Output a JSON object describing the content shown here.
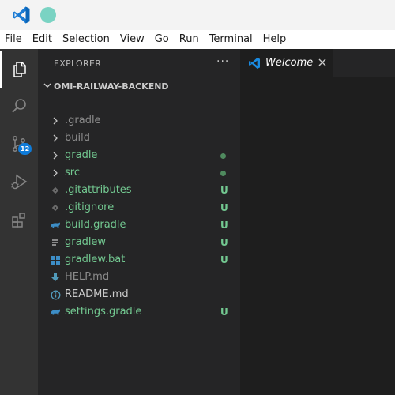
{
  "titlebar": {
    "logo_icon": "vscode-logo-icon",
    "accent": "#7ad3c3"
  },
  "menubar": {
    "items": [
      "File",
      "Edit",
      "Selection",
      "View",
      "Go",
      "Run",
      "Terminal",
      "Help"
    ]
  },
  "activitybar": {
    "items": [
      "explorer-icon",
      "search-icon",
      "source-control-icon",
      "run-debug-icon",
      "extensions-icon"
    ],
    "scm_badge": "12",
    "badge_color": "#0e7bd9"
  },
  "explorer": {
    "header": "EXPLORER",
    "more": "···",
    "project": "OMI-RAILWAY-BACKEND",
    "items": [
      {
        "name": ".gradle",
        "kind": "folder",
        "color": "#8c8c8c",
        "status": ""
      },
      {
        "name": "build",
        "kind": "folder",
        "color": "#8c8c8c",
        "status": ""
      },
      {
        "name": "gradle",
        "kind": "folder",
        "color": "#73c991",
        "status": "dot"
      },
      {
        "name": "src",
        "kind": "folder",
        "color": "#73c991",
        "status": "dot"
      },
      {
        "name": ".gitattributes",
        "kind": "git",
        "color": "#73c991",
        "status": "U"
      },
      {
        "name": ".gitignore",
        "kind": "git",
        "color": "#73c991",
        "status": "U"
      },
      {
        "name": "build.gradle",
        "kind": "gradle",
        "color": "#73c991",
        "status": "U"
      },
      {
        "name": "gradlew",
        "kind": "text",
        "color": "#73c991",
        "status": "U"
      },
      {
        "name": "gradlew.bat",
        "kind": "windows",
        "color": "#73c991",
        "status": "U"
      },
      {
        "name": "HELP.md",
        "kind": "download",
        "color": "#8c8c8c",
        "status": ""
      },
      {
        "name": "README.md",
        "kind": "info",
        "color": "#cccccc",
        "status": ""
      },
      {
        "name": "settings.gradle",
        "kind": "gradle",
        "color": "#73c991",
        "status": "U"
      }
    ]
  },
  "editor": {
    "tab_label": "Welcome",
    "tab_icon": "vscode-logo-icon",
    "close_icon": "close-icon"
  }
}
